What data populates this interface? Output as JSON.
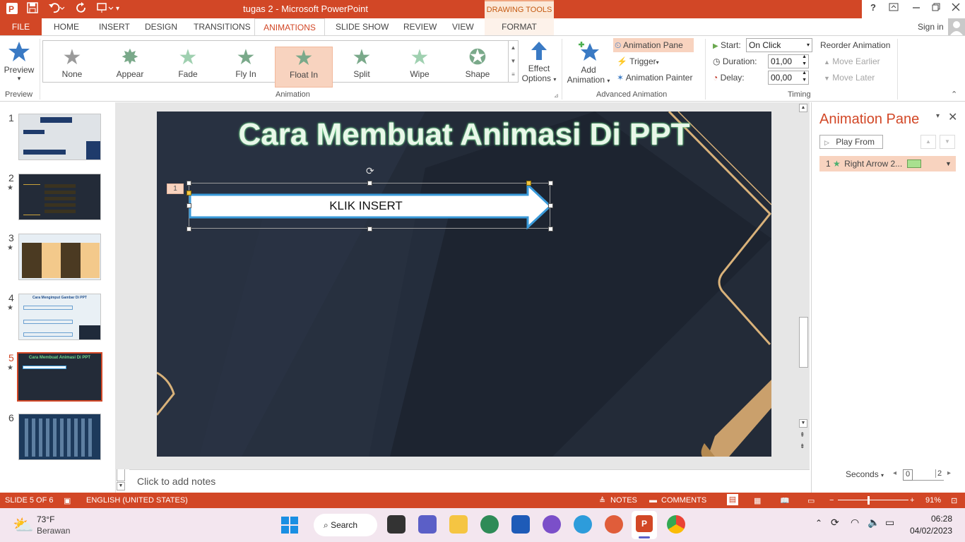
{
  "titlebar": {
    "title": "tugas 2 -  Microsoft PowerPoint",
    "context_tab": "DRAWING TOOLS",
    "help": "?",
    "signin": "Sign in"
  },
  "tabs": [
    "FILE",
    "HOME",
    "INSERT",
    "DESIGN",
    "TRANSITIONS",
    "ANIMATIONS",
    "SLIDE SHOW",
    "REVIEW",
    "VIEW",
    "FORMAT"
  ],
  "ribbon": {
    "preview": {
      "label": "Preview",
      "group": "Preview"
    },
    "gallery": {
      "group": "Animation",
      "items": [
        "None",
        "Appear",
        "Fade",
        "Fly In",
        "Float In",
        "Split",
        "Wipe",
        "Shape"
      ],
      "selected": "Float In"
    },
    "effect_options": [
      "Effect",
      "Options"
    ],
    "add_animation": [
      "Add",
      "Animation"
    ],
    "advanced": {
      "group": "Advanced Animation",
      "animation_pane": "Animation Pane",
      "trigger": "Trigger",
      "painter": "Animation Painter"
    },
    "timing": {
      "group": "Timing",
      "start_label": "Start:",
      "start_value": "On Click",
      "duration_label": "Duration:",
      "duration_value": "01,00",
      "delay_label": "Delay:",
      "delay_value": "00,00",
      "reorder": "Reorder Animation",
      "move_earlier": "Move Earlier",
      "move_later": "Move Later"
    }
  },
  "thumbnails": [
    {
      "num": "1",
      "star": false
    },
    {
      "num": "2",
      "star": true
    },
    {
      "num": "3",
      "star": true
    },
    {
      "num": "4",
      "star": true,
      "title": "Cara Mengimput Gambar Di PPT"
    },
    {
      "num": "5",
      "star": true,
      "title": "Cara Membuat Animasi Di PPT",
      "selected": true
    },
    {
      "num": "6",
      "star": false
    }
  ],
  "slide": {
    "title": "Cara Membuat Animasi Di PPT",
    "arrow_text": "KLIK INSERT",
    "anim_tag": "1"
  },
  "notes_placeholder": "Click to add notes",
  "animation_pane": {
    "title": "Animation Pane",
    "play_from": "Play From",
    "item_index": "1",
    "item_label": "Right Arrow 2...",
    "seconds": "Seconds",
    "scale_start": "0",
    "scale_end": "2"
  },
  "statusbar": {
    "slide_info": "SLIDE 5 OF 6",
    "language": "ENGLISH (UNITED STATES)",
    "notes": "NOTES",
    "comments": "COMMENTS",
    "zoom": "91%"
  },
  "taskbar": {
    "temp": "73°F",
    "weather": "Berawan",
    "search": "Search",
    "time": "06:28",
    "date": "04/02/2023"
  },
  "colors": {
    "accent": "#d24726",
    "selected_gallery": "#f8d3bf",
    "slide_bg": "#232b38",
    "gold": "#d9b27a"
  }
}
